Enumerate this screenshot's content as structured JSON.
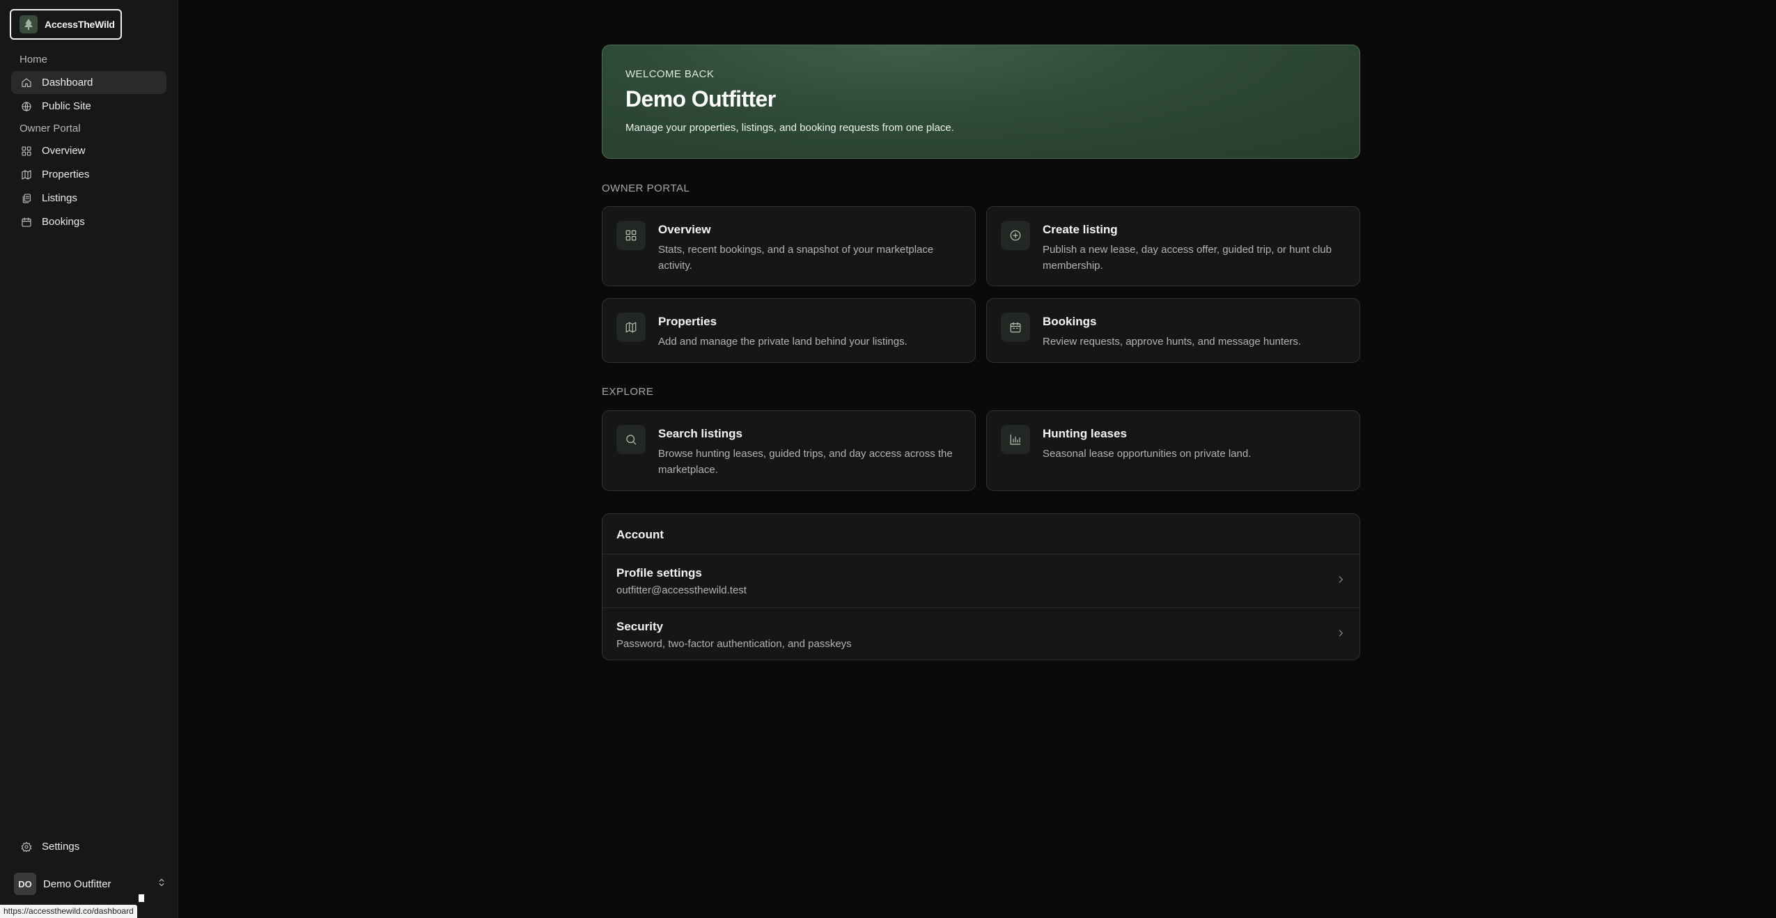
{
  "sidebar": {
    "brand": "AccessTheWild",
    "groups": [
      {
        "label": "Home"
      },
      {
        "label": "Owner Portal"
      }
    ],
    "items": [
      {
        "label": "Dashboard",
        "icon": "home-icon",
        "active": true
      },
      {
        "label": "Public Site",
        "icon": "globe-icon"
      },
      {
        "label": "Overview",
        "icon": "grid-icon"
      },
      {
        "label": "Properties",
        "icon": "map-icon"
      },
      {
        "label": "Listings",
        "icon": "copy-icon"
      },
      {
        "label": "Bookings",
        "icon": "calendar-icon"
      }
    ],
    "settings_label": "Settings",
    "user": {
      "initials": "DO",
      "name": "Demo Outfitter"
    }
  },
  "status_bar_url": "https://accessthewild.co/dashboard",
  "hero": {
    "eyebrow": "WELCOME BACK",
    "title": "Demo Outfitter",
    "subtitle": "Manage your properties, listings, and booking requests from one place."
  },
  "sections": {
    "owner_portal": "OWNER PORTAL",
    "explore": "EXPLORE"
  },
  "cards": [
    {
      "title": "Overview",
      "desc": "Stats, recent bookings, and a snapshot of your marketplace activity.",
      "icon": "grid-icon"
    },
    {
      "title": "Create listing",
      "desc": "Publish a new lease, day access offer, guided trip, or hunt club membership.",
      "icon": "plus-circle-icon"
    },
    {
      "title": "Properties",
      "desc": "Add and manage the private land behind your listings.",
      "icon": "map-icon"
    },
    {
      "title": "Bookings",
      "desc": "Review requests, approve hunts, and message hunters.",
      "icon": "calendar-icon"
    },
    {
      "title": "Search listings",
      "desc": "Browse hunting leases, guided trips, and day access across the marketplace.",
      "icon": "search-icon"
    },
    {
      "title": "Hunting leases",
      "desc": "Seasonal lease opportunities on private land.",
      "icon": "chart-icon"
    }
  ],
  "account": {
    "heading": "Account",
    "rows": [
      {
        "title": "Profile settings",
        "sub": "outfitter@accessthewild.test"
      },
      {
        "title": "Security",
        "sub": "Password, two-factor authentication, and passkeys"
      }
    ]
  },
  "colors": {
    "background": "#0a0a0a",
    "sidebar": "#171717",
    "hero_green": "#2f4a37",
    "card": "#161616"
  }
}
